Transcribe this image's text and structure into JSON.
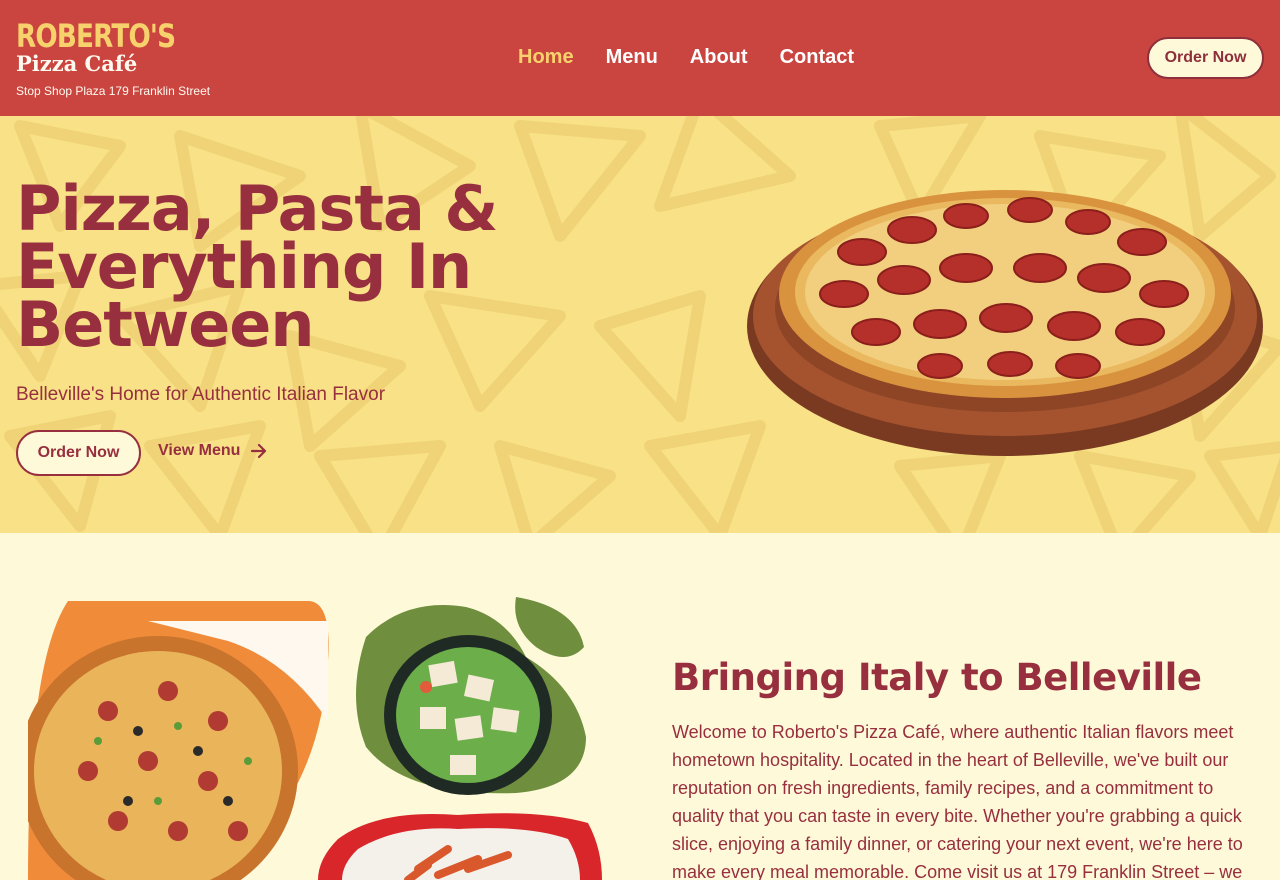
{
  "header": {
    "logo_line1": "ROBERTO'S",
    "logo_line2": "Pizza Café",
    "address": "Stop Shop Plaza 179 Franklin Street",
    "nav": [
      {
        "label": "Home",
        "active": true
      },
      {
        "label": "Menu",
        "active": false
      },
      {
        "label": "About",
        "active": false
      },
      {
        "label": "Contact",
        "active": false
      }
    ],
    "order_button": "Order Now"
  },
  "hero": {
    "title": "Pizza, Pasta & Everything In Between",
    "subtitle": "Belleville's Home for Authentic Italian Flavor",
    "order_button": "Order Now",
    "view_menu_link": "View Menu"
  },
  "about": {
    "title": "Bringing Italy to Belleville",
    "text": "Welcome to Roberto's Pizza Café, where authentic Italian flavors meet hometown hospitality. Located in the heart of Belleville, we've built our reputation on fresh ingredients, family recipes, and a commitment to quality that you can taste in every bite. Whether you're grabbing a quick slice, enjoying a family dinner, or catering your next event, we're here to make every meal memorable. Come visit us at 179 Franklin Street – we"
  },
  "colors": {
    "header_bg": "#cb4540",
    "hero_bg": "#f8e187",
    "page_bg": "#fdf9d9",
    "brand_maroon": "#982f3f",
    "accent_yellow": "#f7d26c"
  },
  "icons": {
    "arrow": "arrow-right-icon"
  }
}
